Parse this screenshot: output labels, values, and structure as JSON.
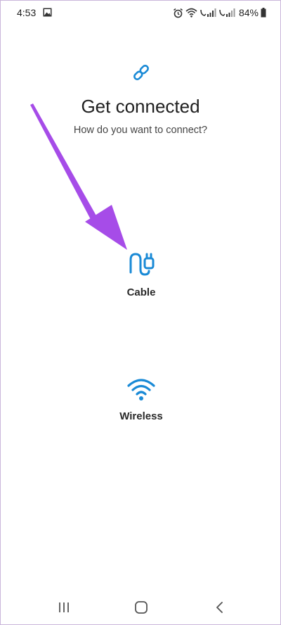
{
  "status_bar": {
    "time": "4:53",
    "battery": "84%"
  },
  "header": {
    "icon": "link-icon",
    "title": "Get connected",
    "subtitle": "How do you want to connect?"
  },
  "options": [
    {
      "label": "Cable",
      "icon": "cable-icon"
    },
    {
      "label": "Wireless",
      "icon": "wifi-icon"
    }
  ],
  "colors": {
    "accent": "#1a8ad6",
    "annotation_arrow": "#a64ce8"
  },
  "nav_bar": {
    "icons": [
      "recents-icon",
      "home-icon",
      "back-icon"
    ]
  }
}
